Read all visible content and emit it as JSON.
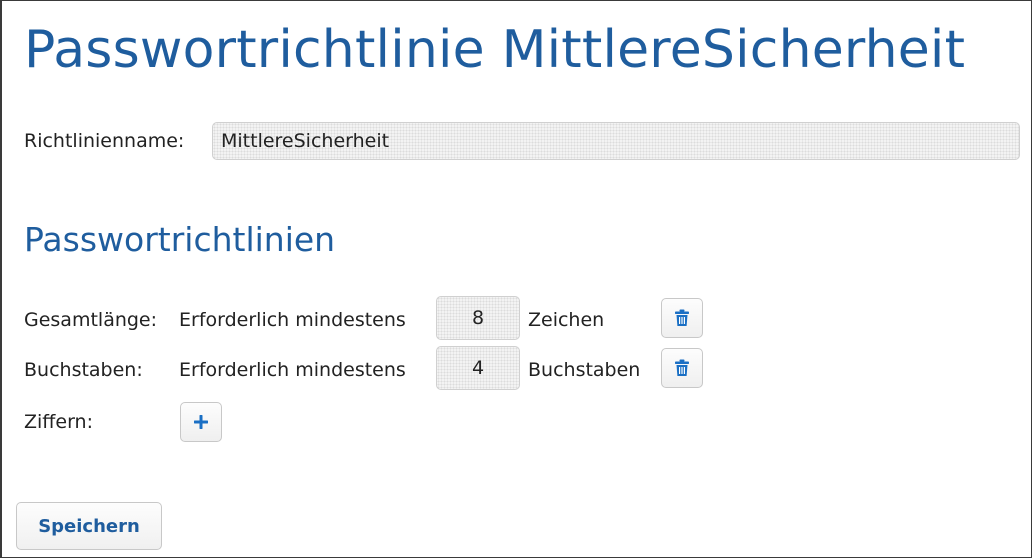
{
  "page": {
    "title": "Passwortrichtlinie MittlereSicherheit"
  },
  "name_row": {
    "label": "Richtlinienname:",
    "value": "MittlereSicherheit"
  },
  "rules_section": {
    "title": "Passwortrichtlinien"
  },
  "rules": [
    {
      "label": "Gesamtlänge:",
      "requirement": "Erforderlich mindestens",
      "value": "8",
      "unit": "Zeichen",
      "delete_icon": "trash-icon"
    },
    {
      "label": "Buchstaben:",
      "requirement": "Erforderlich mindestens",
      "value": "4",
      "unit": "Buchstaben",
      "delete_icon": "trash-icon"
    },
    {
      "label": "Ziffern:",
      "add_icon": "plus-icon"
    }
  ],
  "actions": {
    "save_label": "Speichern"
  },
  "colors": {
    "accent": "#1f5d9e",
    "icon": "#1a6fc4"
  }
}
